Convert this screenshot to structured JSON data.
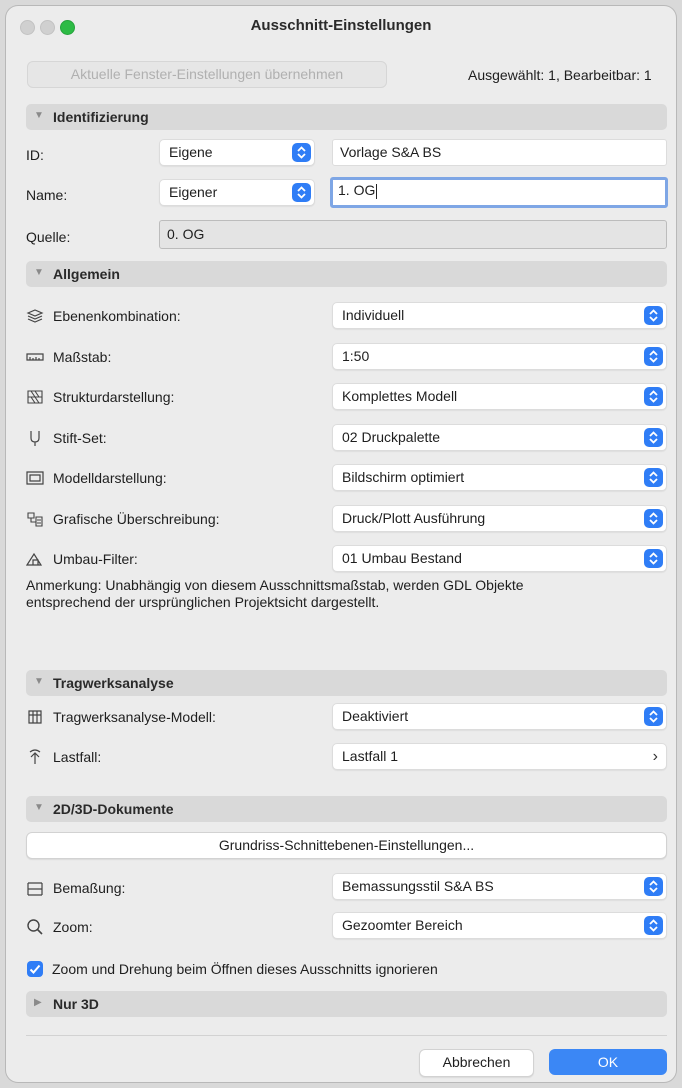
{
  "window": {
    "title": "Ausschnitt-Einstellungen"
  },
  "top": {
    "apply_button": "Aktuelle Fenster-Einstellungen übernehmen",
    "status": "Ausgewählt: 1, Bearbeitbar: 1"
  },
  "identifizierung": {
    "header": "Identifizierung",
    "id_label": "ID:",
    "id_mode": "Eigene",
    "id_value": "Vorlage S&A BS",
    "name_label": "Name:",
    "name_mode": "Eigener",
    "name_value": "1. OG",
    "source_label": "Quelle:",
    "source_value": "0. OG"
  },
  "allgemein": {
    "header": "Allgemein",
    "rows": [
      {
        "icon": "layers-icon",
        "label": "Ebenenkombination:",
        "value": "Individuell"
      },
      {
        "icon": "ruler-icon",
        "label": "Maßstab:",
        "value": "1:50"
      },
      {
        "icon": "structure-icon",
        "label": "Strukturdarstellung:",
        "value": "Komplettes Modell"
      },
      {
        "icon": "pen-icon",
        "label": "Stift-Set:",
        "value": "02 Druckpalette"
      },
      {
        "icon": "model-display-icon",
        "label": "Modelldarstellung:",
        "value": "Bildschirm optimiert"
      },
      {
        "icon": "graphic-override-icon",
        "label": "Grafische Überschreibung:",
        "value": "Druck/Plott Ausführung"
      },
      {
        "icon": "renovation-icon",
        "label": "Umbau-Filter:",
        "value": "01 Umbau Bestand"
      }
    ],
    "note_line1": "Anmerkung: Unabhängig von diesem Ausschnittsmaßstab, werden GDL Objekte",
    "note_line2": "entsprechend der ursprünglichen Projektsicht dargestellt."
  },
  "tragwerk": {
    "header": "Tragwerksanalyse",
    "model_label": "Tragwerksanalyse-Modell:",
    "model_value": "Deaktiviert",
    "load_label": "Lastfall:",
    "load_value": "Lastfall 1"
  },
  "docs": {
    "header": "2D/3D-Dokumente",
    "cut_plane_button": "Grundriss-Schnittebenen-Einstellungen...",
    "dim_label": "Bemaßung:",
    "dim_value": "Bemassungsstil S&A BS",
    "zoom_label": "Zoom:",
    "zoom_value": "Gezoomter Bereich",
    "ignore_zoom_label": "Zoom und Drehung beim Öffnen dieses Ausschnitts ignorieren",
    "ignore_zoom_checked": true
  },
  "nur3d": {
    "header": "Nur 3D"
  },
  "footer": {
    "cancel": "Abbrechen",
    "ok": "OK"
  },
  "colors": {
    "accent": "#2f7df6",
    "ok_button": "#3b87f5",
    "section_bg": "#d9d9d9"
  }
}
